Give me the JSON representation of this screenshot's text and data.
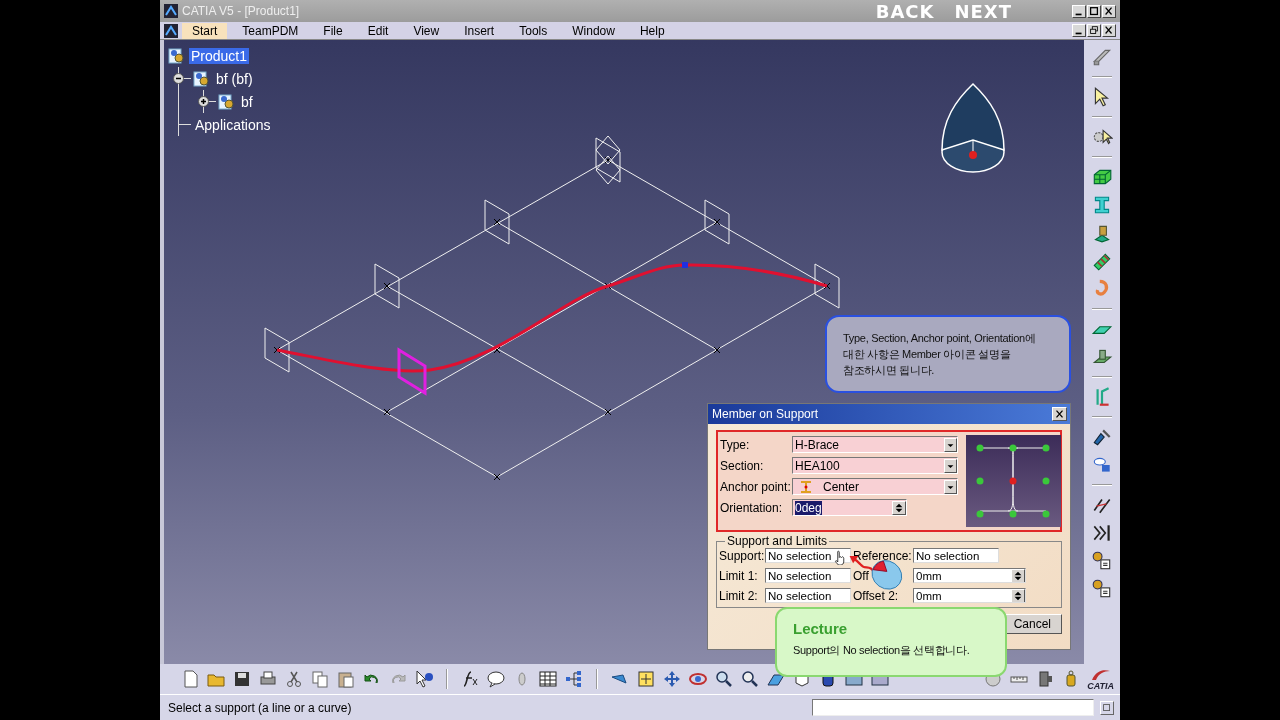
{
  "window": {
    "title": "CATIA V5 - [Product1]",
    "nav": [
      "BACK",
      "NEXT"
    ]
  },
  "menu": [
    {
      "label": "Start",
      "selected": true
    },
    {
      "label": "TeamPDM",
      "selected": false
    },
    {
      "label": "File",
      "selected": false
    },
    {
      "label": "Edit",
      "selected": false
    },
    {
      "label": "View",
      "selected": false
    },
    {
      "label": "Insert",
      "selected": false
    },
    {
      "label": "Tools",
      "selected": false
    },
    {
      "label": "Window",
      "selected": false
    },
    {
      "label": "Help",
      "selected": false
    }
  ],
  "tree": {
    "label": "Product1",
    "selected": true,
    "children": [
      {
        "label": "bf (bf)",
        "selected": false,
        "expanded": true,
        "children": [
          {
            "label": "bf",
            "selected": false,
            "expanded": false
          }
        ]
      },
      {
        "label": "Applications",
        "selected": false
      }
    ]
  },
  "note": {
    "text": "Type, Section, Anchor point, Orientation에\n대한 사항은 Member 아이콘 설명을\n참조하시면 됩니다."
  },
  "dialog": {
    "title": "Member on Support",
    "fields": [
      {
        "label": "Type:",
        "value": "H-Brace",
        "kind": "combo"
      },
      {
        "label": "Section:",
        "value": "HEA100",
        "kind": "combo"
      },
      {
        "label": "Anchor point:",
        "value": "Center",
        "kind": "combo-icon"
      },
      {
        "label": "Orientation:",
        "value": "0deg",
        "kind": "spinner",
        "text_selected": true
      }
    ],
    "support_and_limits": {
      "title": "Support and Limits",
      "rows": [
        {
          "label": "Support:",
          "value": "No selection",
          "aux": {
            "label": "Reference:",
            "value": "No selection",
            "kind": "text"
          }
        },
        {
          "label": "Limit 1:",
          "value": "No selection",
          "aux": {
            "label": "Off",
            "value": "0mm",
            "kind": "spinner"
          }
        },
        {
          "label": "Limit 2:",
          "value": "No selection",
          "aux": {
            "label": "Offset 2:",
            "value": "0mm",
            "kind": "spinner"
          }
        }
      ]
    },
    "buttons": [
      "Cancel"
    ]
  },
  "lecture": {
    "title": "Lecture",
    "text": "Support의 No selection을 선택합니다."
  },
  "logo": {
    "text": "CATIA"
  },
  "status_bar": {
    "message": "Select a support (a line or a curve)"
  }
}
